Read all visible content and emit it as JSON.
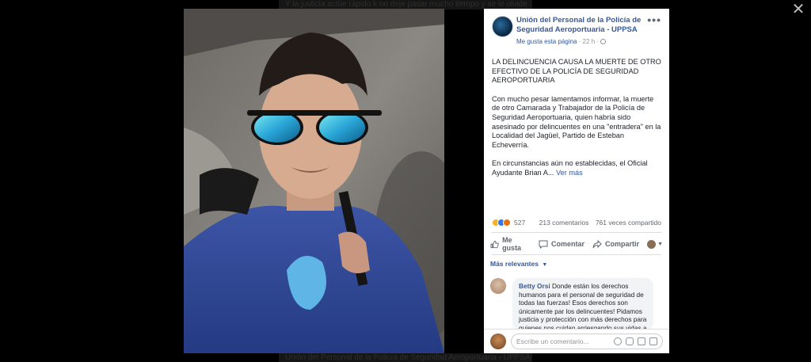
{
  "background": {
    "top_text": "Y la justicia actúe rápido k no deje pasar mucho tiempo y se le olvide",
    "bottom_text": "Unión del Personal de la Policía de Seguridad Aeroportuaria - UPPSA"
  },
  "viewer": {
    "close_label": "✕"
  },
  "post": {
    "page_name": "Unión del Personal de la Policía de Seguridad Aeroportuaria - UPPSA",
    "like_page": "Me gusta esta página",
    "time": "22 h",
    "more_label": "•••",
    "paragraphs": [
      "LA DELINCUENCIA CAUSA LA MUERTE DE OTRO EFECTIVO DE LA POLICÍA DE SEGURIDAD AEROPORTUARIA",
      "Con mucho pesar lamentamos informar, la muerte de otro Camarada y Trabajador de la Policía de Seguridad Aeroportuaria, quien habría sido asesinado por delincuentes en una \"entradera\" en la Localidad del Jagüel, Partido de Esteban Echeverría."
    ],
    "last_paragraph": "En circunstancias aún no establecidas, el Oficial Ayudante Brian A...",
    "see_more": "Ver más"
  },
  "stats": {
    "reactions": "527",
    "comments": "213 comentarios",
    "shares": "761 veces compartido"
  },
  "actions": {
    "like": "Me gusta",
    "comment": "Comentar",
    "share": "Compartir"
  },
  "comments": {
    "filter": "Más relevantes",
    "items": [
      {
        "author": "Betty Orsi",
        "text": "Donde están los derechos humanos para el personal de seguridad de todas las fuerzas! Esos derechos son únicamente par los delincuentes! Pidamos justicia y protección con más derechos para quienes nos cuidan arriesgando sus vidas a diario"
      }
    ]
  },
  "composer": {
    "placeholder": "Escribe un comentario..."
  },
  "colors": {
    "link": "#365899",
    "text": "#1d2129",
    "muted": "#606770",
    "backdrop": "#000000"
  }
}
